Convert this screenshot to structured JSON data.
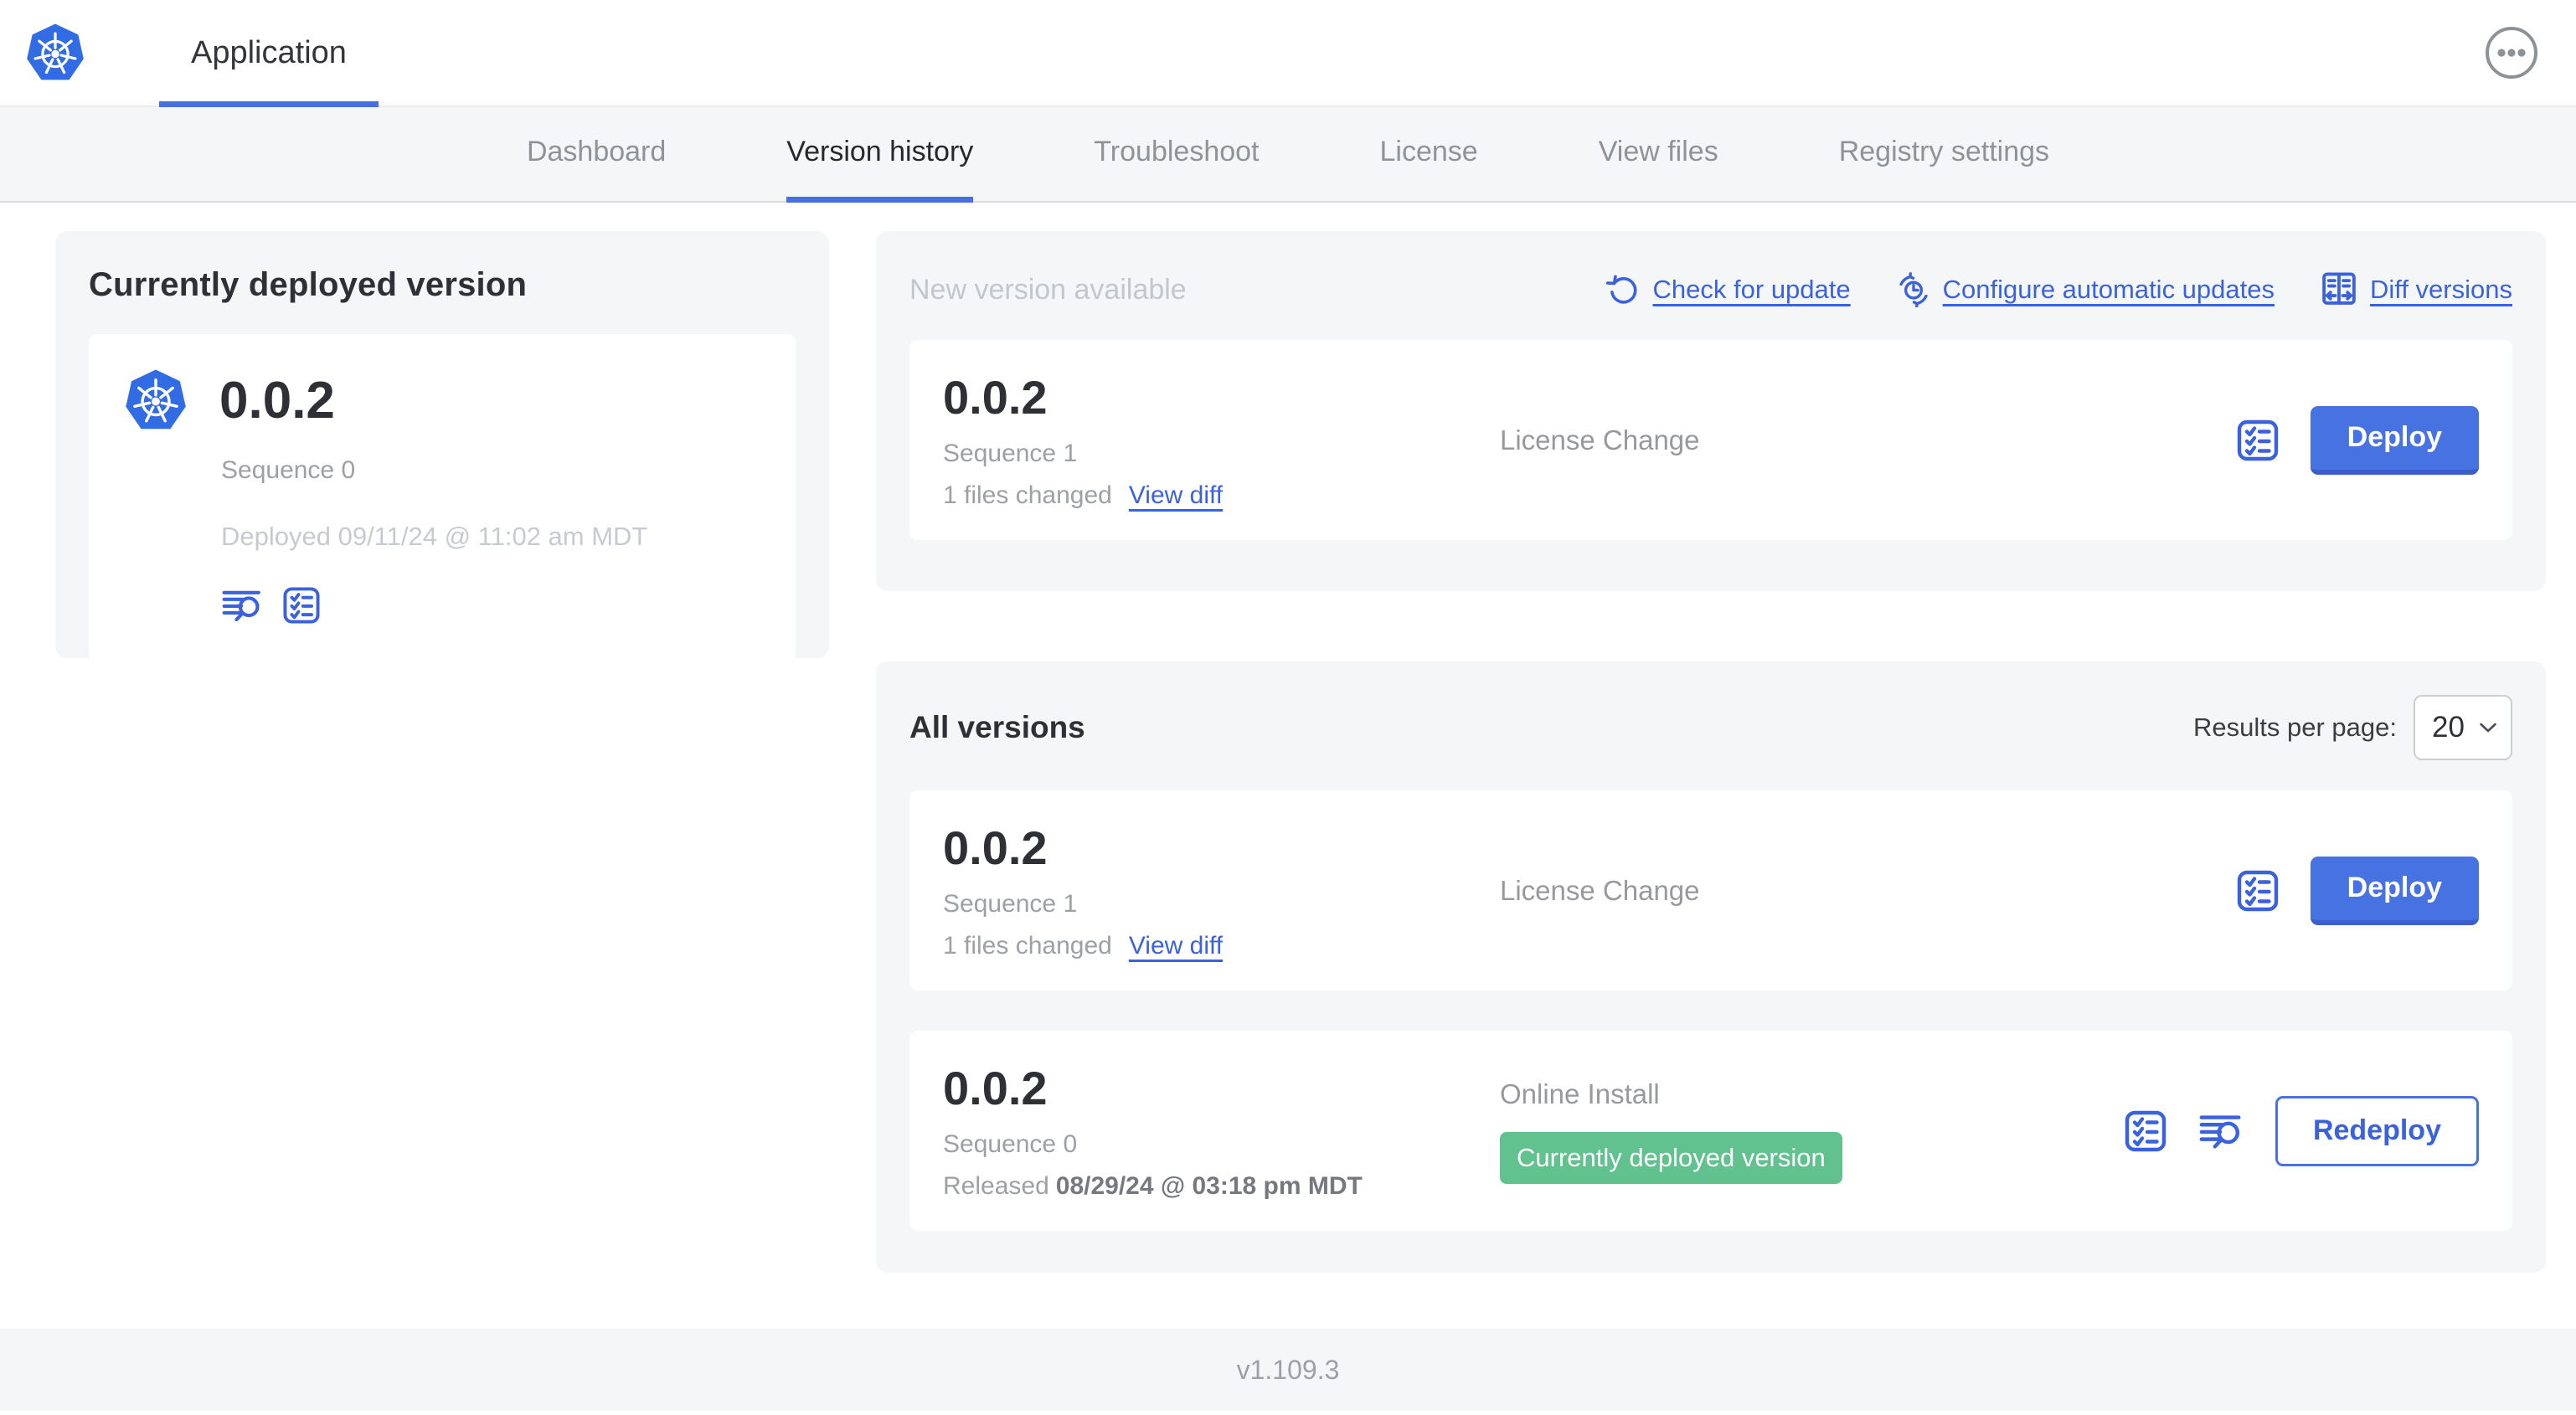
{
  "header": {
    "title": "Application"
  },
  "nav": {
    "active_tab": "Version history",
    "tabs": [
      {
        "label": "Dashboard"
      },
      {
        "label": "Version history"
      },
      {
        "label": "Troubleshoot"
      },
      {
        "label": "License"
      },
      {
        "label": "View files"
      },
      {
        "label": "Registry settings"
      }
    ]
  },
  "currently_deployed": {
    "title": "Currently deployed version",
    "version": "0.0.2",
    "sequence": "Sequence 0",
    "deployed": "Deployed 09/11/24 @ 11:02 am MDT",
    "icons": [
      "logs-icon",
      "checklist-icon"
    ]
  },
  "new_version": {
    "title": "New version available",
    "actions": [
      {
        "label": "Check for update",
        "icon": "refresh-icon"
      },
      {
        "label": "Configure automatic updates",
        "icon": "schedule-icon"
      },
      {
        "label": "Diff versions",
        "icon": "diff-icon"
      }
    ],
    "row": {
      "version": "0.0.2",
      "sequence": "Sequence 1",
      "files_changed": "1 files changed",
      "view_diff": "View diff",
      "source": "License Change",
      "action": "Deploy",
      "icons": [
        "checklist-icon"
      ]
    }
  },
  "all_versions": {
    "title": "All versions",
    "results_per_page_label": "Results per page:",
    "results_per_page_value": "20",
    "rows": [
      {
        "version": "0.0.2",
        "sequence": "Sequence 1",
        "files_changed": "1 files changed",
        "view_diff": "View diff",
        "source": "License Change",
        "action": "Deploy",
        "icons": [
          "checklist-icon"
        ]
      },
      {
        "version": "0.0.2",
        "sequence": "Sequence 0",
        "released_label": "Released",
        "released_date": "08/29/24 @ 03:18 pm MDT",
        "source": "Online Install",
        "badge": "Currently deployed version",
        "action": "Redeploy",
        "icons": [
          "checklist-icon",
          "logs-icon"
        ]
      }
    ]
  },
  "footer": {
    "app_version": "v1.109.3"
  },
  "colors": {
    "accent_blue": "#4673e1",
    "link_blue": "#3b62de",
    "badge_green": "#61c28f",
    "card_bg": "#f5f6f8",
    "kubernetes_blue": "#326ce5"
  }
}
